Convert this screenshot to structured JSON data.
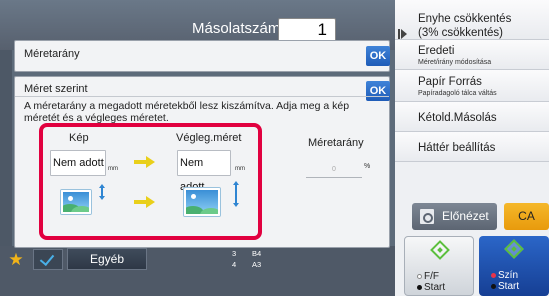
{
  "header": {
    "copies_label": "Másolatszám",
    "copies_value": "1"
  },
  "right_panel": {
    "items": [
      {
        "title": "Enyhe csökkentés",
        "title2": "(3% csökkentés)",
        "sub": ""
      },
      {
        "title": "Eredeti",
        "sub": "Méret/irány módosítása"
      },
      {
        "title": "Papír Forrás",
        "sub": "Papíradagoló tálca váltás"
      },
      {
        "title": "Kétold.Másolás",
        "sub": ""
      },
      {
        "title": "Háttér beállítás",
        "sub": ""
      }
    ],
    "preview_label": "Előnézet",
    "ca_label": "CA",
    "start_bw": {
      "line1": "F/F",
      "line2": "Start"
    },
    "start_color": {
      "line1": "Szín",
      "line2": "Start"
    }
  },
  "bottom": {
    "other_label": "Egyéb",
    "trays": [
      {
        "num": "3",
        "size": "B4"
      },
      {
        "num": "4",
        "size": "A3"
      }
    ]
  },
  "dialog_ratio": {
    "title": "Méretarány",
    "ok": "OK"
  },
  "dialog_size": {
    "title": "Méret szerint",
    "ok": "OK",
    "description": "A méretarány a megadott méretekből lesz kiszámítva. Adja meg a kép méretét és a végleges méretet.",
    "col_image": "Kép",
    "col_final": "Végleg.méret",
    "image_value": "Nem adott",
    "final_value": "Nem adott",
    "unit_mm": "mm",
    "ratio_label": "Méretarány",
    "ratio_value": "0",
    "ratio_unit": "%"
  },
  "colors": {
    "highlight": "#e1003f",
    "ok_blue": "#1f5cb8",
    "arrow_yellow": "#e9cf1a"
  }
}
